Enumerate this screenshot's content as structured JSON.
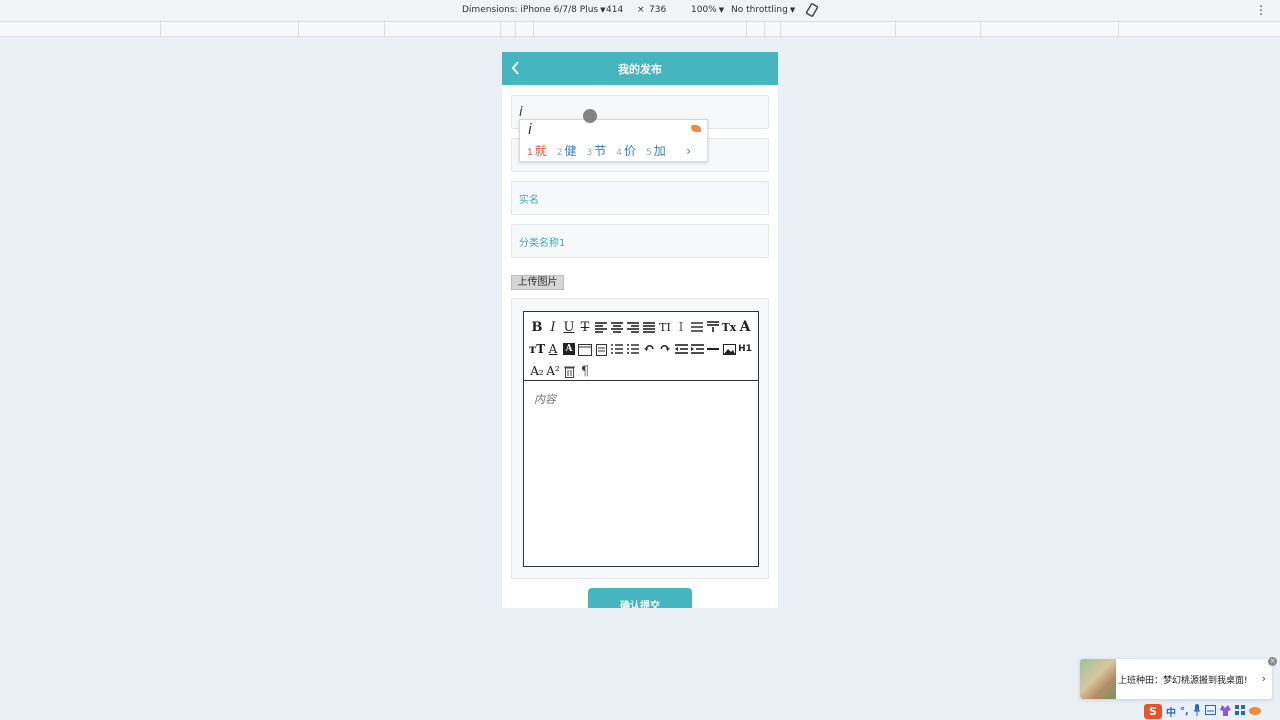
{
  "devtools": {
    "device_label": "Dimensions: iPhone 6/7/8 Plus",
    "width": "414",
    "times": "×",
    "height": "736",
    "zoom": "100%",
    "throttling": "No throttling",
    "caret": "▼",
    "menu": "⋮"
  },
  "header": {
    "title": "我的发布"
  },
  "form": {
    "field1_text": "i",
    "field3_placeholder": "实名",
    "field4_placeholder": "分类名称1",
    "upload_label": "上传图片",
    "content_placeholder": "内容",
    "submit_label": "确认提交"
  },
  "ime": {
    "composition": "i",
    "candidates": [
      {
        "num": "1",
        "text": "就"
      },
      {
        "num": "2",
        "text": "健"
      },
      {
        "num": "3",
        "text": "节"
      },
      {
        "num": "4",
        "text": "价"
      },
      {
        "num": "5",
        "text": "加"
      }
    ],
    "next": "›"
  },
  "notification": {
    "text": "上班种田：梦幻桃源搬到我桌面!",
    "arrow": "›",
    "close": "×"
  },
  "tray": {
    "ime_logo": "S",
    "lang": "中",
    "punct": "°,"
  }
}
